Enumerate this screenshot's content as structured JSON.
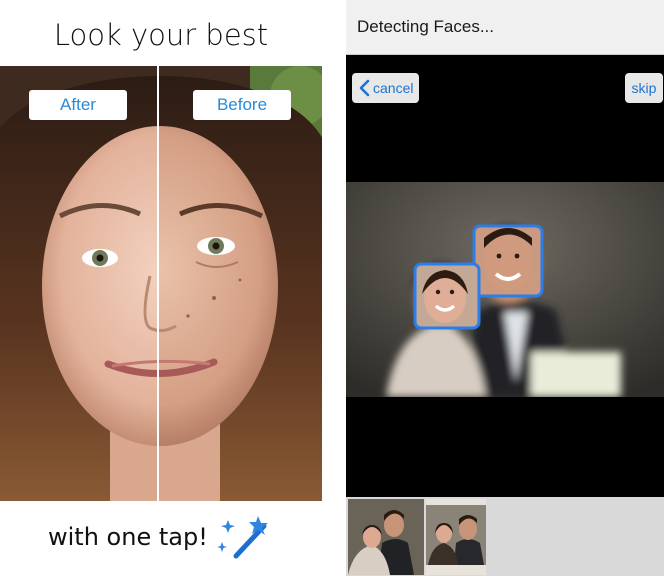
{
  "promo": {
    "headline": "Look your best",
    "after_label": "After",
    "before_label": "Before",
    "tagline": "with one tap!"
  },
  "app": {
    "status_title": "Detecting Faces...",
    "cancel_label": "cancel",
    "skip_label": "skip",
    "detected_faces": 2,
    "thumbnail_count": 2
  },
  "colors": {
    "accent": "#1a73d6",
    "face_box": "#2b7de9",
    "pill_text": "#2a8ad8"
  },
  "icons": [
    "magic-wand-icon",
    "chevron-left-icon"
  ]
}
